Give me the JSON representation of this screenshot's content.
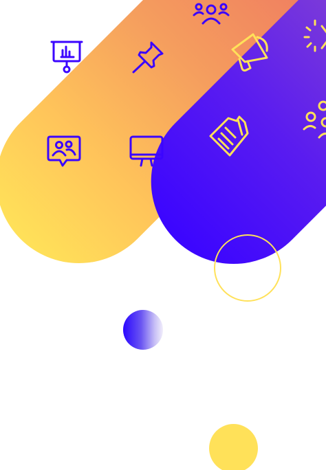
{
  "palette": {
    "warm_start": "#FFE159",
    "warm_end": "#F08060",
    "cool_start": "#3B05FF",
    "cool_end": "#9A55C8",
    "icon_on_warm": "#3B05FF",
    "icon_on_cool": "#FFE159",
    "accent_yellow": "#FFE159"
  },
  "shapes": {
    "warm_pill": "diagonal-rounded-band",
    "cool_pill": "diagonal-rounded-band",
    "outline_circle": "ring",
    "gradient_circle": "blue-to-white-disc",
    "solid_circle": "yellow-disc"
  },
  "icons": {
    "warm_band": [
      "presentation-chart-icon",
      "pushpin-icon",
      "team-icon",
      "video-meeting-icon",
      "monitor-icon"
    ],
    "cool_band": [
      "megaphone-icon",
      "idea-sparkle-icon",
      "document-icon",
      "people-group-icon"
    ]
  }
}
